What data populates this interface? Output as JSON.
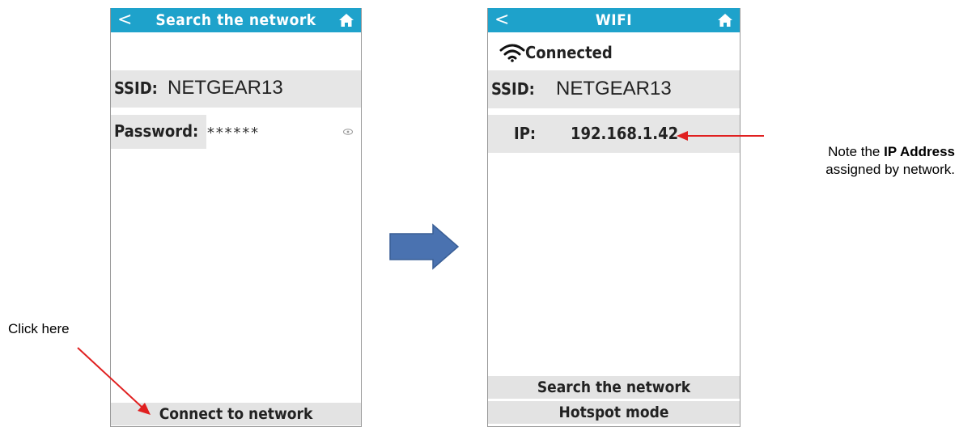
{
  "screen1": {
    "topbar": {
      "back_icon": "chevron-left-icon",
      "back_glyph": "<",
      "title": "Search the network",
      "home_icon": "home-icon"
    },
    "ssid": {
      "label": "SSID:",
      "value": "NETGEAR13"
    },
    "password": {
      "label": "Password:",
      "value": "******",
      "toggle_icon": "eye-icon"
    },
    "connect_button": "Connect to network"
  },
  "screen2": {
    "topbar": {
      "back_icon": "chevron-left-icon",
      "back_glyph": "<",
      "title": "WIFI",
      "home_icon": "home-icon"
    },
    "status": {
      "icon": "wifi-icon",
      "text": "Connected"
    },
    "ssid": {
      "label": "SSID:",
      "value": "NETGEAR13"
    },
    "ip": {
      "label": "IP:",
      "value": "192.168.1.42"
    },
    "search_button": "Search the network",
    "hotspot_button": "Hotspot mode"
  },
  "annotations": {
    "note_prefix": "Note the ",
    "note_bold": "IP Address",
    "note_line2": "assigned by network.",
    "click_here": "Click here"
  },
  "colors": {
    "topbar": "#1ea2cb",
    "row_bg": "#e6e6e6",
    "arrow_red": "#e02020",
    "flow_arrow": "#4a72b0"
  }
}
